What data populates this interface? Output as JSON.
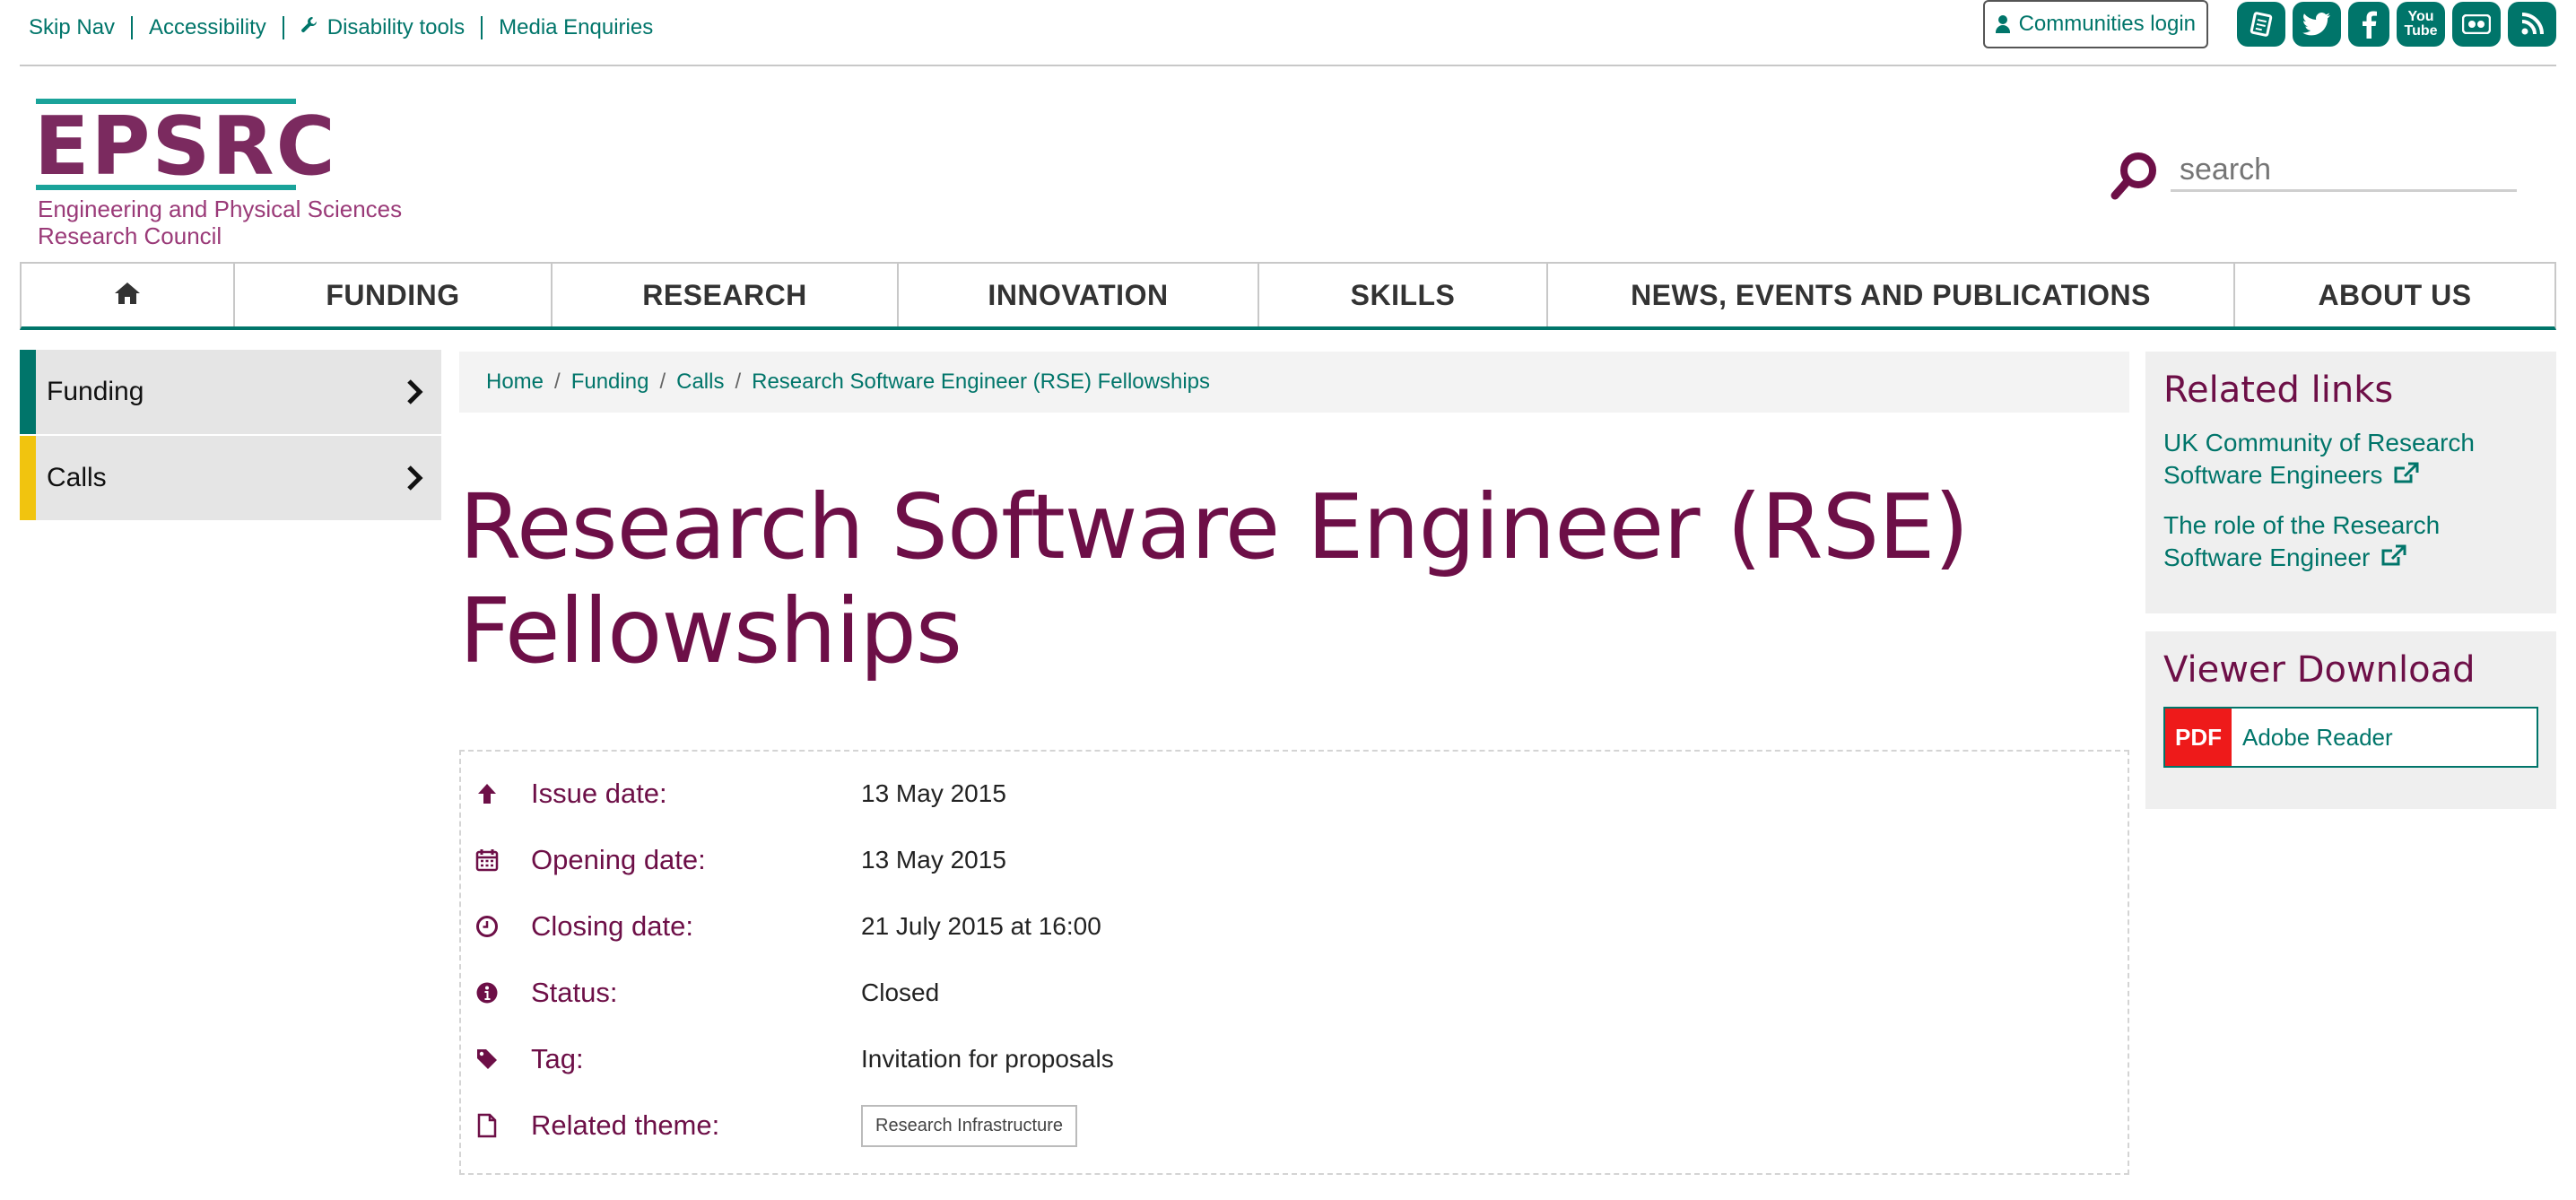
{
  "utility": {
    "links": [
      "Skip Nav",
      "Accessibility",
      "Disability tools",
      "Media Enquiries"
    ],
    "communities_login": "Communities login",
    "social_youtube_text": "You Tube"
  },
  "logo": {
    "word": "EPSRC",
    "line1": "Engineering and Physical Sciences",
    "line2": "Research Council"
  },
  "search": {
    "placeholder": "search"
  },
  "nav": {
    "items": [
      "FUNDING",
      "RESEARCH",
      "INNOVATION",
      "SKILLS",
      "NEWS, EVENTS AND PUBLICATIONS",
      "ABOUT US"
    ]
  },
  "sidebar": {
    "items": [
      {
        "label": "Funding",
        "stripe": "#00756a"
      },
      {
        "label": "Calls",
        "stripe": "#f1c40f"
      }
    ]
  },
  "breadcrumb": [
    "Home",
    "Funding",
    "Calls",
    "Research Software Engineer (RSE) Fellowships"
  ],
  "title": {
    "line1": "Research Software Engineer (RSE)",
    "line2": "Fellowships"
  },
  "details": {
    "issue_label": "Issue date:",
    "issue_value": "13 May 2015",
    "opening_label": "Opening date:",
    "opening_value": "13 May 2015",
    "closing_label": "Closing date:",
    "closing_value": "21 July 2015 at 16:00",
    "status_label": "Status:",
    "status_value": "Closed",
    "tag_label": "Tag:",
    "tag_value": "Invitation for proposals",
    "theme_label": "Related theme:",
    "theme_value": "Research Infrastructure"
  },
  "related": {
    "heading": "Related links",
    "links": [
      {
        "line1": "UK Community of Research",
        "line2": "Software Engineers"
      },
      {
        "line1": "The role of the Research",
        "line2": "Software Engineer"
      }
    ]
  },
  "viewer": {
    "heading": "Viewer Download",
    "badge": "PDF",
    "label": "Adobe Reader"
  },
  "colors": {
    "teal": "#00756a",
    "plum": "#6d0f47",
    "yellow": "#f1c40f",
    "pdf_red": "#ee1a1a"
  }
}
